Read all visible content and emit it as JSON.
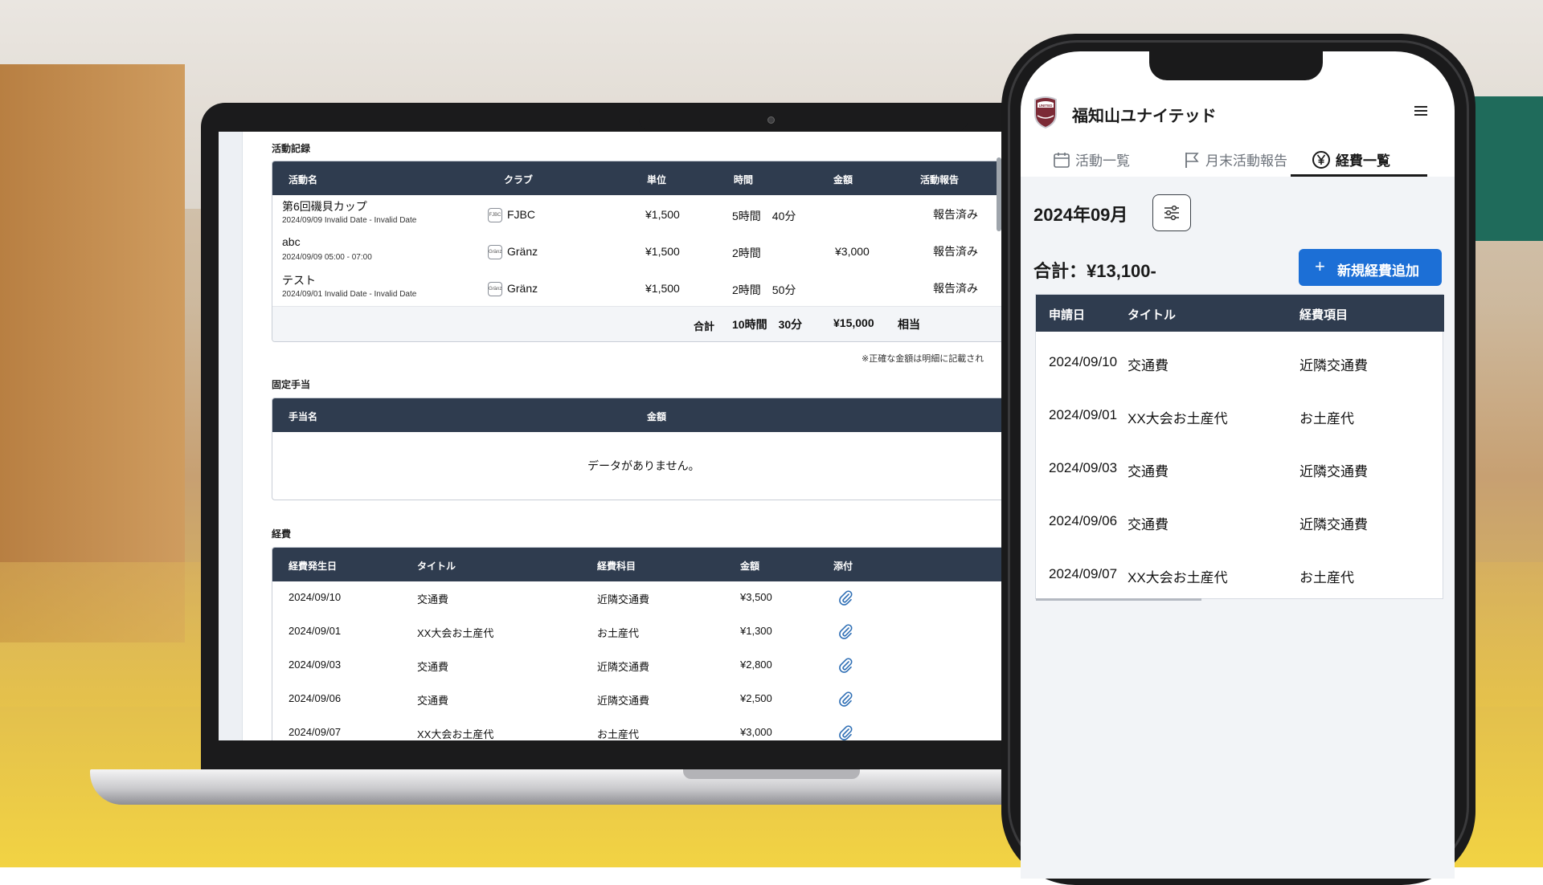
{
  "laptop": {
    "activity": {
      "section_title": "活動記録",
      "headers": [
        "活動名",
        "クラブ",
        "単位",
        "時間",
        "金額",
        "活動報告"
      ],
      "rows": [
        {
          "name": "第6回磯貝カップ",
          "date": "2024/09/09 Invalid Date - Invalid Date",
          "club_icon": "FJBC",
          "club": "FJBC",
          "unit": "¥1,500",
          "time": "5時間　40分",
          "amount": "",
          "report": "報告済み"
        },
        {
          "name": "abc",
          "date": "2024/09/09 05:00 - 07:00",
          "club_icon": "Gränz",
          "club": "Gränz",
          "unit": "¥1,500",
          "time": "2時間",
          "amount": "¥3,000",
          "report": "報告済み"
        },
        {
          "name": "テスト",
          "date": "2024/09/01 Invalid Date - Invalid Date",
          "club_icon": "Gränz",
          "club": "Gränz",
          "unit": "¥1,500",
          "time": "2時間　50分",
          "amount": "",
          "report": "報告済み"
        }
      ],
      "total_label": "合計",
      "total_time": "10時間　30分",
      "total_amount": "¥15,000",
      "total_suffix": "相当",
      "note": "※正確な金額は明細に記載され"
    },
    "allowance": {
      "section_title": "固定手当",
      "headers": [
        "手当名",
        "金額"
      ],
      "empty": "データがありません。"
    },
    "expenses": {
      "section_title": "経費",
      "headers": [
        "経費発生日",
        "タイトル",
        "経費科目",
        "金額",
        "添付"
      ],
      "rows": [
        {
          "date": "2024/09/10",
          "title": "交通費",
          "category": "近隣交通費",
          "amount": "¥3,500"
        },
        {
          "date": "2024/09/01",
          "title": "XX大会お土産代",
          "category": "お土産代",
          "amount": "¥1,300"
        },
        {
          "date": "2024/09/03",
          "title": "交通費",
          "category": "近隣交通費",
          "amount": "¥2,800"
        },
        {
          "date": "2024/09/06",
          "title": "交通費",
          "category": "近隣交通費",
          "amount": "¥2,500"
        },
        {
          "date": "2024/09/07",
          "title": "XX大会お土産代",
          "category": "お土産代",
          "amount": "¥3,000"
        }
      ]
    }
  },
  "phone": {
    "team_name": "福知山ユナイテッド",
    "logo_text": "UNITED",
    "tabs": [
      {
        "label": "活動一覧",
        "icon": "calendar-icon"
      },
      {
        "label": "月末活動報告",
        "icon": "flag-icon"
      },
      {
        "label": "経費一覧",
        "icon": "yen-icon"
      }
    ],
    "month": "2024年09月",
    "total": "合計：¥13,100-",
    "add_button": "新規経費追加",
    "headers": [
      "申請日",
      "タイトル",
      "経費項目"
    ],
    "rows": [
      {
        "date": "2024/09/10",
        "title": "交通費",
        "item": "近隣交通費"
      },
      {
        "date": "2024/09/01",
        "title": "XX大会お土産代",
        "item": "お土産代"
      },
      {
        "date": "2024/09/03",
        "title": "交通費",
        "item": "近隣交通費"
      },
      {
        "date": "2024/09/06",
        "title": "交通費",
        "item": "近隣交通費"
      },
      {
        "date": "2024/09/07",
        "title": "XX大会お土産代",
        "item": "お土産代"
      }
    ]
  },
  "colors": {
    "header": "#2f3c4f",
    "accent": "#1c6fd6",
    "clip": "#2f6fb5"
  }
}
